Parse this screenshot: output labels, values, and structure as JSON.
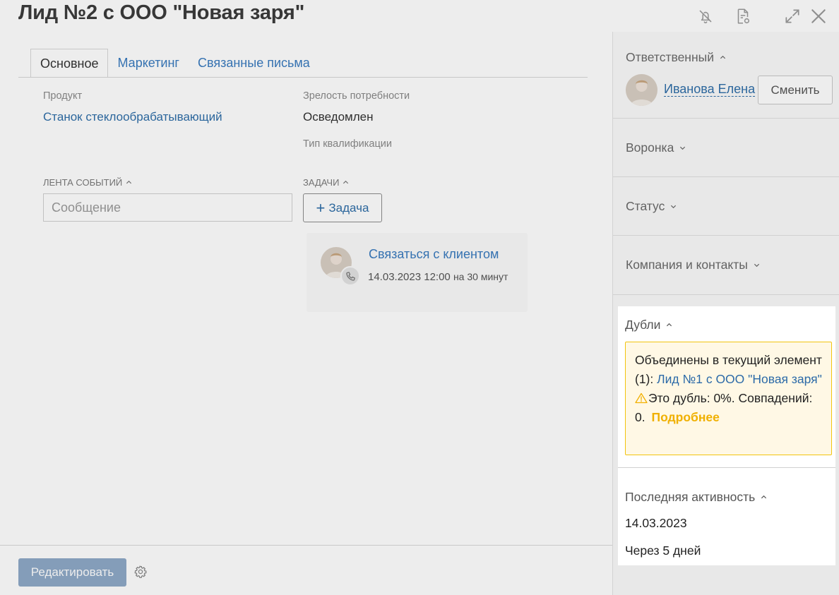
{
  "header": {
    "title": "Лид №2 с ООО \"Новая заря\"",
    "icons": [
      "bell-off-icon",
      "document-settings-icon",
      "expand-icon",
      "close-icon"
    ]
  },
  "tabs": [
    {
      "label": "Основное",
      "active": true
    },
    {
      "label": "Маркетинг",
      "active": false
    },
    {
      "label": "Связанные письма",
      "active": false
    }
  ],
  "fields": {
    "product_label": "Продукт",
    "product_value": "Станок стеклообрабатывающий",
    "maturity_label": "Зрелость потребности",
    "maturity_value": "Осведомлен",
    "qualification_label": "Тип квалификации"
  },
  "feed": {
    "label": "ЛЕНТА СОБЫТИЙ",
    "placeholder": "Сообщение"
  },
  "tasks": {
    "label": "ЗАДАЧИ",
    "add_button": "Задача",
    "items": [
      {
        "title": "Связаться с клиентом",
        "date": "14.03.2023 12:00",
        "duration": "на 30 минут"
      }
    ]
  },
  "footer": {
    "edit_button": "Редактировать"
  },
  "sidebar": {
    "responsible": {
      "label": "Ответственный",
      "name": "Иванова Елена",
      "change_button": "Сменить"
    },
    "funnel_label": "Воронка",
    "status_label": "Статус",
    "company_label": "Компания и контакты",
    "duplicates": {
      "label": "Дубли",
      "merged_text": "Объединены в текущий элемент (1):",
      "merged_link": "Лид №1 с ООО \"Новая заря\"",
      "warning_text": "Это дубль: 0%. Совпадений: 0.",
      "more_link": "Подробнее"
    },
    "last_activity": {
      "label": "Последняя активность",
      "date": "14.03.2023",
      "relative": "Через 5 дней"
    }
  },
  "colors": {
    "link": "#2f6ea8",
    "warning_border": "#f2c40f",
    "warning_bg": "#fff8e5",
    "warning_link": "#f0b000",
    "primary_button": "#8fa9c8"
  }
}
